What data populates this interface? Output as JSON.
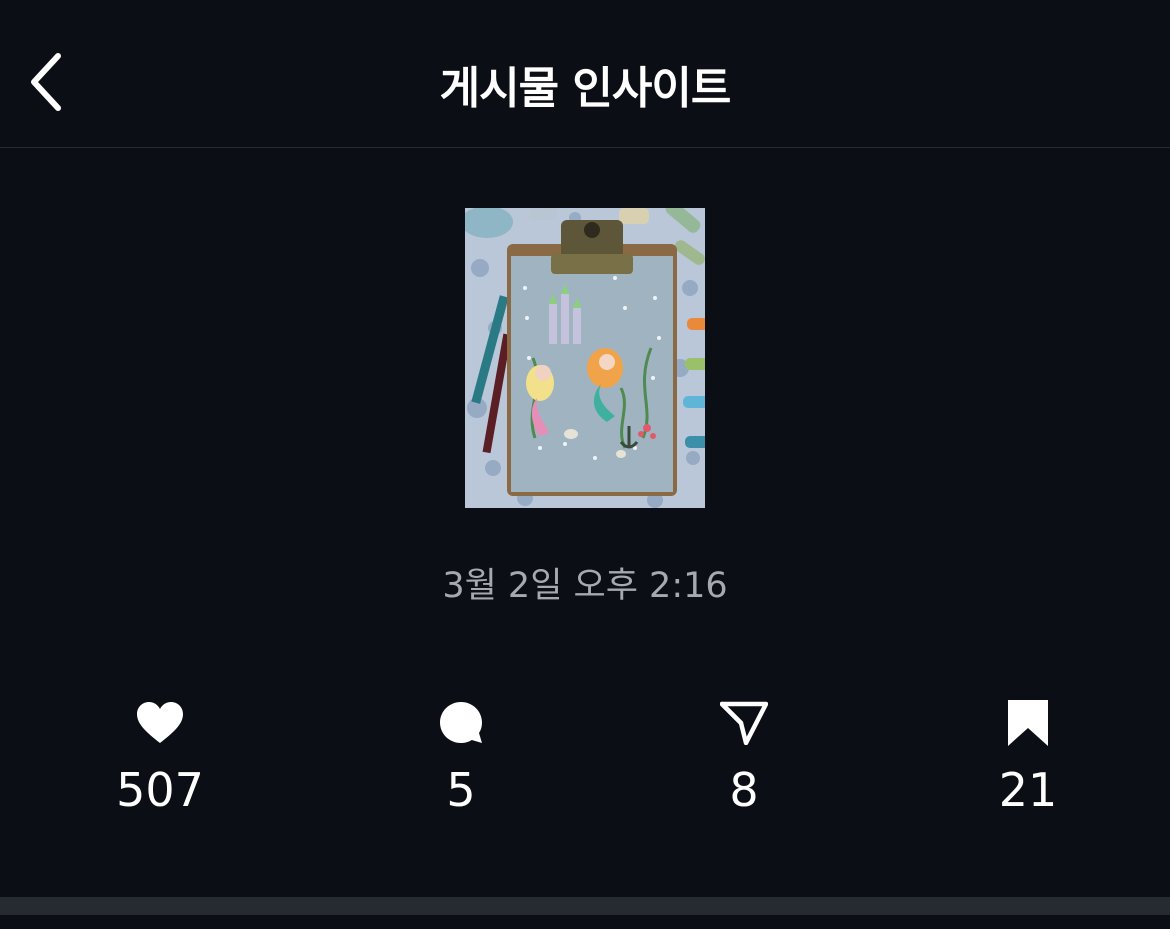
{
  "header": {
    "title": "게시물 인사이트",
    "back_icon": "chevron-left-icon"
  },
  "post": {
    "thumbnail_description_icon": "post-thumbnail",
    "timestamp": "3월 2일 오후 2:16"
  },
  "stats": [
    {
      "icon": "heart-icon",
      "count": "507"
    },
    {
      "icon": "comment-icon",
      "count": "5"
    },
    {
      "icon": "share-icon",
      "count": "8"
    },
    {
      "icon": "bookmark-icon",
      "count": "21"
    }
  ],
  "colors": {
    "background": "#0b0e14",
    "divider": "#262a31",
    "text_primary": "#ffffff",
    "text_secondary": "#a5a9b0"
  }
}
